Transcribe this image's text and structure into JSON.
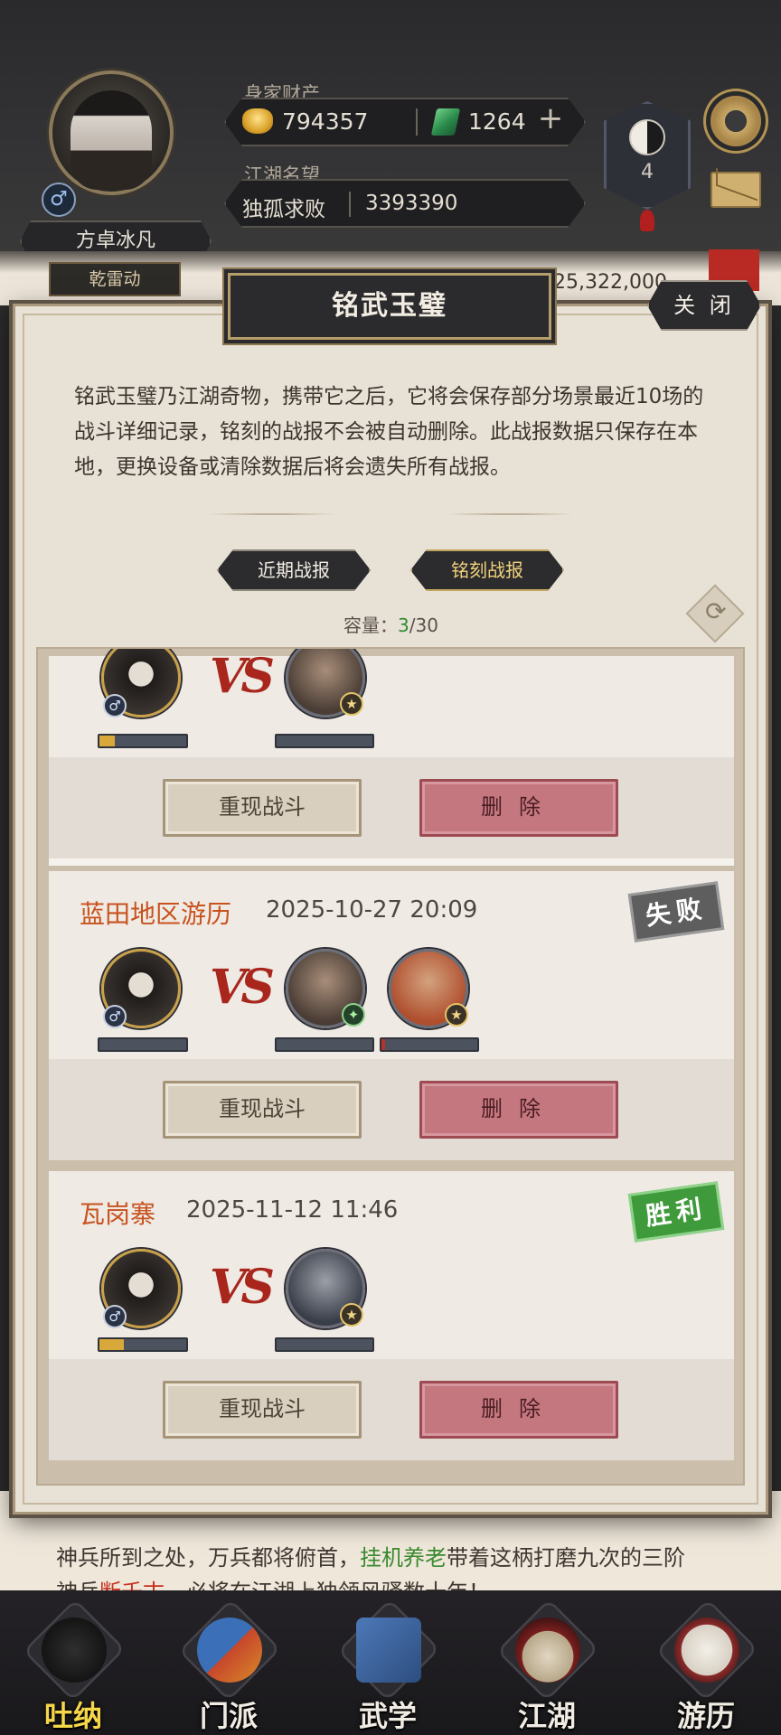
{
  "header": {
    "player_name": "方卓冰凡",
    "sect": "乾雷动",
    "gender_symbol": "♂",
    "wealth_label": "身家财产",
    "coins": "794357",
    "jade": "1264",
    "plus": "+",
    "reputation_label": "江湖名望",
    "reputation_title": "独孤求败",
    "reputation_value": "3393390",
    "medal_level": "4",
    "bg_stat": "25,322,000"
  },
  "modal": {
    "title": "铭武玉璧",
    "close_label": "关 闭",
    "description": "铭武玉璧乃江湖奇物，携带它之后，它将会保存部分场景最近10场的战斗详细记录，铭刻的战报不会被自动删除。此战报数据只保存在本地，更换设备或清除数据后将会遗失所有战报。",
    "tabs": [
      {
        "label": "近期战报",
        "active": false
      },
      {
        "label": "铭刻战报",
        "active": true
      }
    ],
    "capacity_label": "容量：",
    "capacity_used": "3",
    "capacity_total": "/30",
    "records": [
      {
        "location": "",
        "time": "",
        "result": "",
        "vs": "VS",
        "replay_label": "重现战斗",
        "delete_label": "删除"
      },
      {
        "location": "蓝田地区游历",
        "time": "2025-10-27 20:09",
        "result": "失败",
        "vs": "VS",
        "replay_label": "重现战斗",
        "delete_label": "删除"
      },
      {
        "location": "瓦岗寨",
        "time": "2025-11-12 11:46",
        "result": "胜利",
        "vs": "VS",
        "replay_label": "重现战斗",
        "delete_label": "删除"
      }
    ]
  },
  "story": {
    "line1_a": "神兵所到之处，万兵都将俯首，",
    "line1_green": "挂机养老",
    "line1_b": "带着这柄打磨九次的三阶",
    "line2_a": "神兵",
    "line2_red": "断千古",
    "line2_b": "，必将在江湖上独领风骚数十年！"
  },
  "nav": [
    {
      "label": "吐纳",
      "icon": "meditation-icon",
      "active": true
    },
    {
      "label": "门派",
      "icon": "sect-icon",
      "active": false
    },
    {
      "label": "武学",
      "icon": "martial-book-icon",
      "active": false
    },
    {
      "label": "江湖",
      "icon": "straw-hat-icon",
      "active": false
    },
    {
      "label": "游历",
      "icon": "horse-icon",
      "active": false
    }
  ],
  "colors": {
    "accent_gold": "#c8a04a",
    "location_orange": "#c8521e",
    "delete_red": "#c4777f",
    "win_green": "#3f9a3c",
    "lose_gray": "#5e5e5e"
  }
}
